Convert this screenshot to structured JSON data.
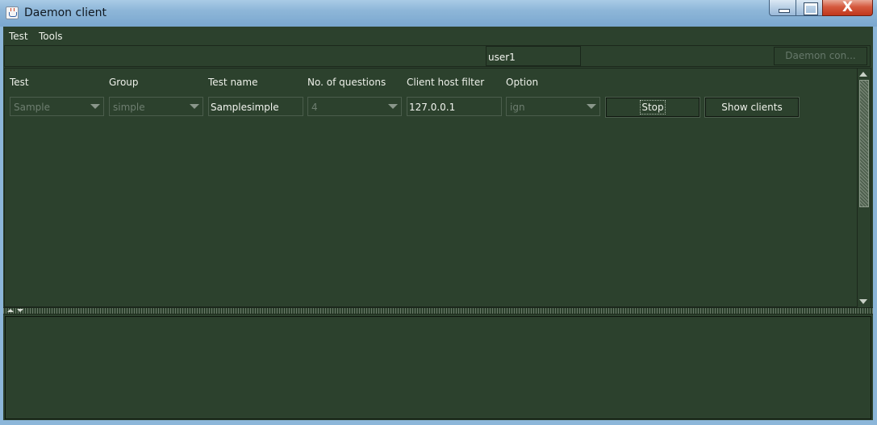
{
  "window": {
    "title": "Daemon client",
    "close_glyph": "X"
  },
  "menu": [
    {
      "label": "Test"
    },
    {
      "label": "Tools"
    }
  ],
  "toolbar": {
    "user": "user1",
    "daemon_button": "Daemon con..."
  },
  "form": {
    "columns": [
      "Test",
      "Group",
      "Test name",
      "No. of questions",
      "Client host filter",
      "Option"
    ],
    "test_value": "Sample",
    "group_value": "simple",
    "test_name_value": "Samplesimple",
    "questions_value": "4",
    "host_filter_value": "127.0.0.1",
    "option_value": "ign",
    "stop_button": "Stop",
    "show_clients_button": "Show clients"
  },
  "icons": [
    "java-app-icon",
    "minimize-icon",
    "maximize-icon",
    "close-icon",
    "dropdown-arrow-icon",
    "scroll-up-icon",
    "scroll-down-icon",
    "split-up-icon",
    "split-down-icon"
  ],
  "colors": {
    "background": "#2c412d",
    "text": "#eef1ea",
    "disabled_text": "#6e7e70",
    "titlebar": "#8db6d8",
    "close": "#c0371d"
  }
}
